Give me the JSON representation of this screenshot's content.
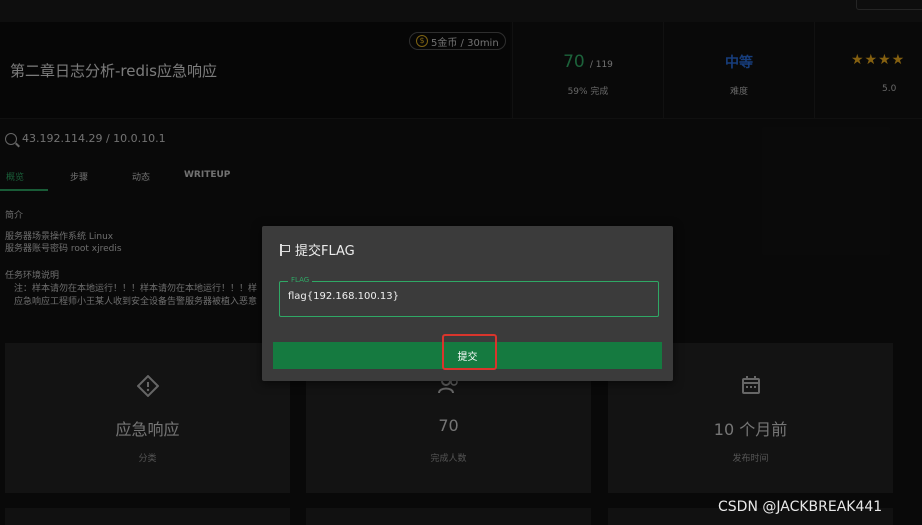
{
  "header": {
    "title": "第二章日志分析-redis应急响应",
    "coin_badge": "5金币 / 30min",
    "coin_icon": "coin-icon",
    "progress": {
      "value": "70",
      "total": "/ 119",
      "label": "59% 完成"
    },
    "difficulty": {
      "value": "中等",
      "label": "难度"
    },
    "rating": {
      "stars": "★★★★",
      "value": "5.0"
    }
  },
  "target": {
    "ip": "43.192.114.29 / 10.0.10.1"
  },
  "tabs": [
    {
      "label": "概览",
      "active": true
    },
    {
      "label": "步骤"
    },
    {
      "label": "动态"
    },
    {
      "label": "WRITEUP"
    }
  ],
  "description": {
    "intro_heading": "简介",
    "intro_lines": [
      "服务器场景操作系统 Linux",
      "服务器账号密码 root xjredis"
    ],
    "env_heading": "任务环境说明",
    "env_lines": [
      "注：样本请勿在本地运行！！！样本请勿在本地运行！！！样",
      "应急响应工程师小王某人收到安全设备告警服务器被植入恶意"
    ]
  },
  "cards": [
    {
      "icon": "alert-diamond-icon",
      "main": "应急响应",
      "sub": "分类"
    },
    {
      "icon": "users-icon",
      "main": "70",
      "sub": "完成人数"
    },
    {
      "icon": "calendar-icon",
      "main": "10 个月前",
      "sub": "发布时间"
    }
  ],
  "modal": {
    "title": "提交FLAG",
    "field_label": "FLAG",
    "field_value": "flag{192.168.100.13}",
    "submit_label": "提交"
  },
  "watermark": "CSDN @JACKBREAK441",
  "colors": {
    "accent_green": "#2fa865",
    "button_green": "#157a40",
    "difficulty_blue": "#2a6fe0",
    "star_gold": "#f2b01e",
    "highlight_red": "#d9352c"
  }
}
